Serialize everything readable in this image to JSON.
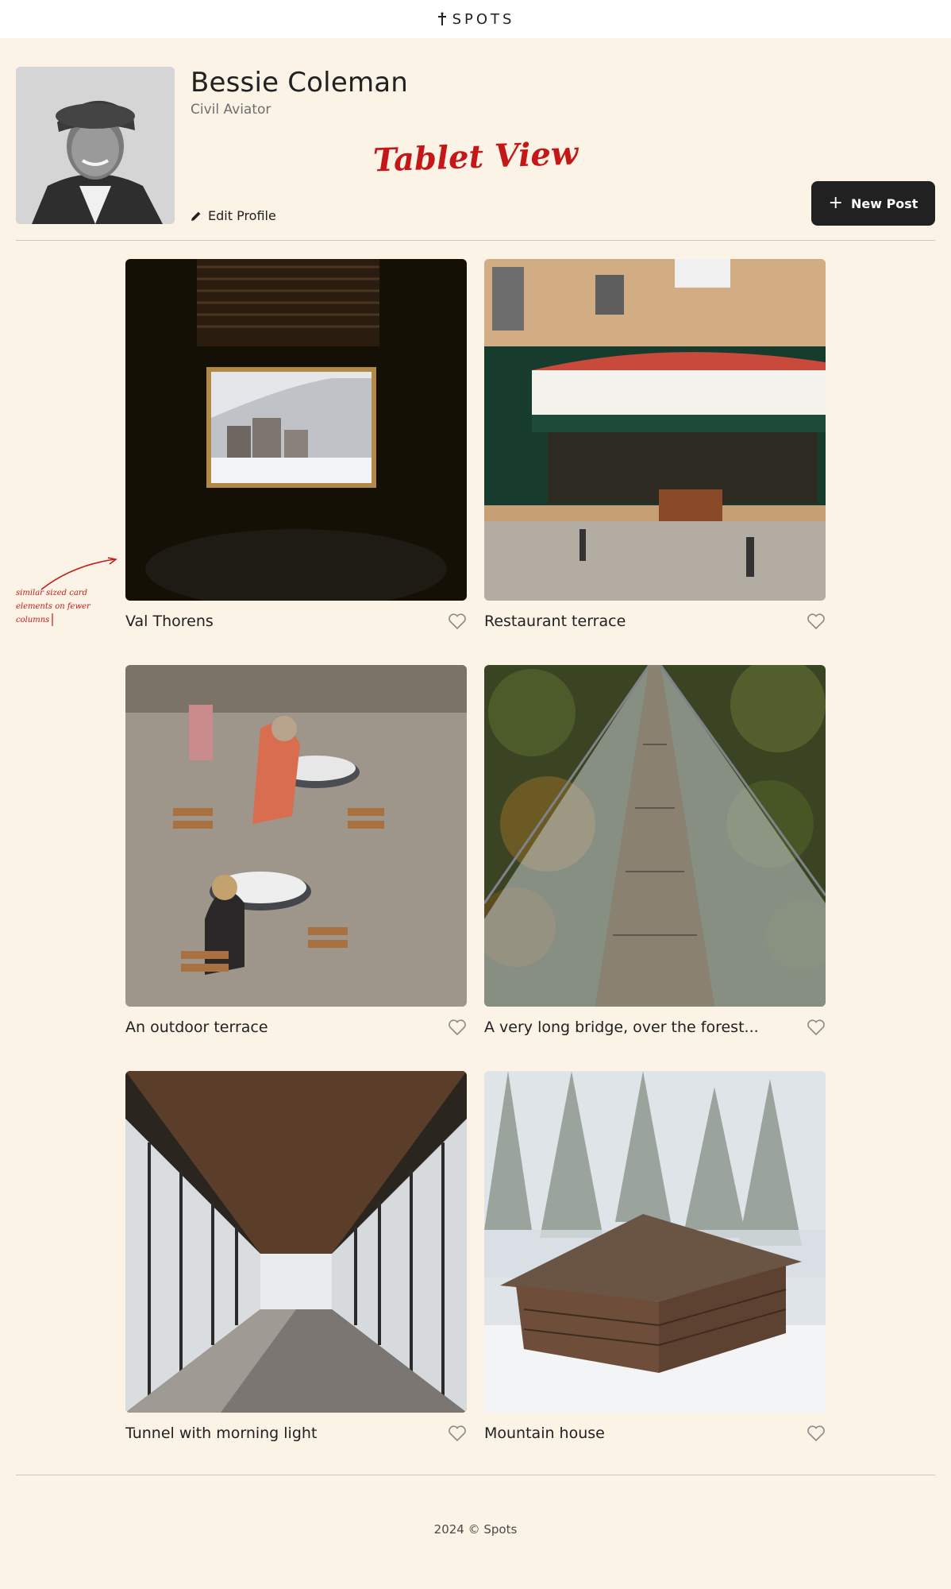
{
  "header": {
    "logo_text": "SPOTS",
    "logo_icon": "spots-logo-icon"
  },
  "profile": {
    "name": "Bessie Coleman",
    "description": "Civil Aviator",
    "edit_label": "Edit Profile",
    "new_post_label": "New Post",
    "avatar_icon": "avatar-photo"
  },
  "annotations": {
    "title": "Tablet View",
    "side_note": "similar sized card elements on fewer columns"
  },
  "cards": [
    {
      "title": "Val Thorens"
    },
    {
      "title": "Restaurant terrace"
    },
    {
      "title": "An outdoor terrace"
    },
    {
      "title": "A very long bridge, over the forest..."
    },
    {
      "title": "Tunnel with morning light"
    },
    {
      "title": "Mountain house"
    }
  ],
  "footer": {
    "text": "2024 © Spots"
  },
  "colors": {
    "background": "#fbf3e6",
    "text": "#212121",
    "annotation": "#c41818",
    "button": "#212121"
  }
}
